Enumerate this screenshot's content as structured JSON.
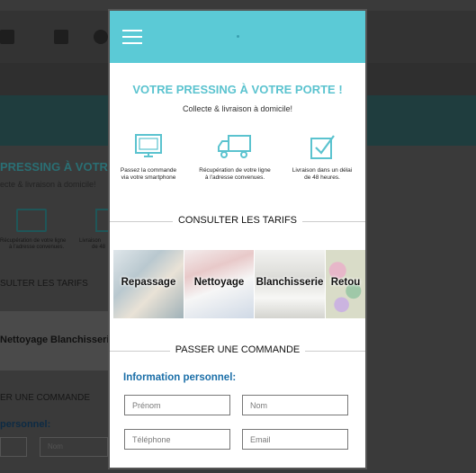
{
  "background": {
    "title": "PRESSING À VOTRE POR",
    "subtitle": "ecte & livraison à domicile!",
    "feature_1": "Récupération de votre ligne",
    "feature_1b": "à l'adresse convenues.",
    "feature_2": "Livraison",
    "feature_2b": "de 48",
    "section_tarifs": "SULTER LES TARIFS",
    "tile_1": "Nettoyage",
    "tile_2": "Blanchisserie",
    "section_commande": "ER UNE COMMANDE",
    "form_label": "personnel:",
    "input_nom": "Nom"
  },
  "app": {
    "hero_title": "VOTRE PRESSING À VOTRE PORTE !",
    "hero_subtitle": "Collecte & livraison à domicile!",
    "features": [
      {
        "line1": "Passez la commande",
        "line2": "via votre smartphone",
        "icon": "monitor-icon"
      },
      {
        "line1": "Récupération de votre ligne",
        "line2": "à l'adresse convenues.",
        "icon": "truck-icon"
      },
      {
        "line1": "Livraison dans un délai",
        "line2": "de 48 heures.",
        "icon": "checkbox-icon"
      }
    ],
    "section_tarifs": "CONSULTER LES TARIFS",
    "tiles": [
      "Repassage",
      "Nettoyage",
      "Blanchisserie",
      "Retou"
    ],
    "section_commande": "PASSER UNE COMMANDE",
    "form_label": "Information personnel:",
    "placeholders": {
      "prenom": "Prénom",
      "nom": "Nom",
      "telephone": "Téléphone",
      "email": "Email"
    }
  },
  "colors": {
    "accent": "#5bcad6",
    "title": "#5bc3cf",
    "form_label": "#1b6fa8"
  }
}
